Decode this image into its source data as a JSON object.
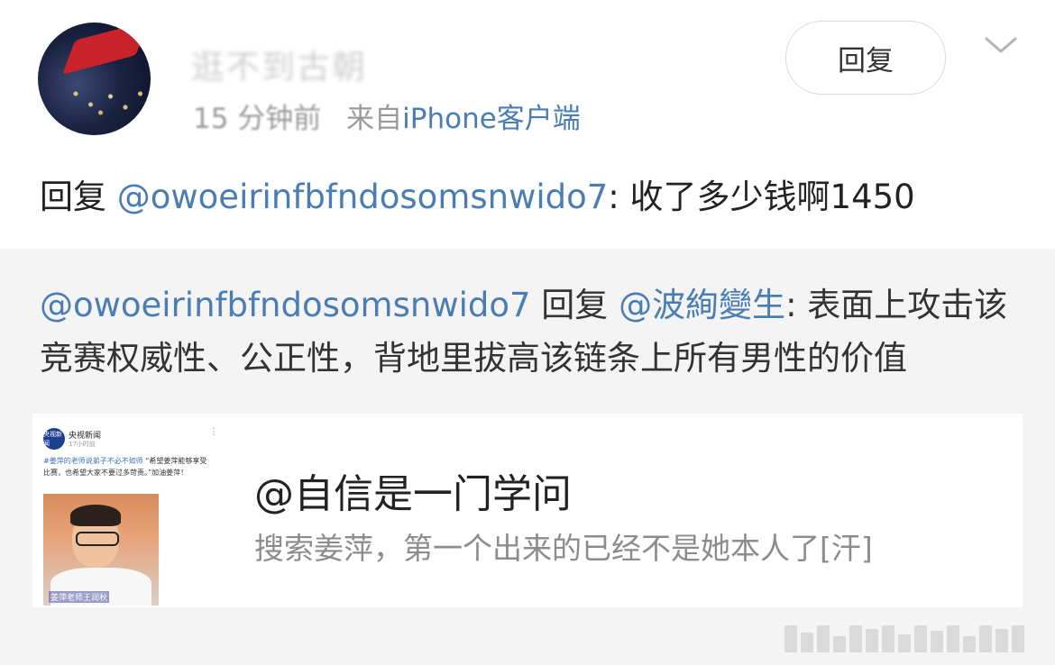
{
  "header": {
    "username": "逛不到古朝",
    "time": "15 分钟前",
    "source_prefix": "来自",
    "client": "iPhone客户端",
    "reply_button": "回复"
  },
  "comment": {
    "prefix": "回复 ",
    "mention": "@owoeirinfbfndosomsnwido7",
    "text": ": 收了多少钱啊1450"
  },
  "quoted": {
    "author": "@owoeirinfbfndosomsnwido7",
    "reply_word": " 回复 ",
    "target": "@波絢變生",
    "text": ": 表面上攻击该竞赛权威性、公正性，背地里拔高该链条上所有男性的价值"
  },
  "card": {
    "title": "@自信是一门学问",
    "desc": "搜索姜萍，第一个出来的已经不是她本人了[汗]",
    "thumb": {
      "logo_text": "央视新闻",
      "account": "央视新闻",
      "time": "17小时前",
      "tag": "#姜萍的老师说弟子不必不如师",
      "body": "“希望姜萍能够享受比赛，也希望大家不要过多苛责。”加油姜萍！",
      "caption": "姜萍老师王润秋"
    }
  },
  "colors": {
    "link": "#4a7db3",
    "quote_bg": "#f4f4f4"
  }
}
